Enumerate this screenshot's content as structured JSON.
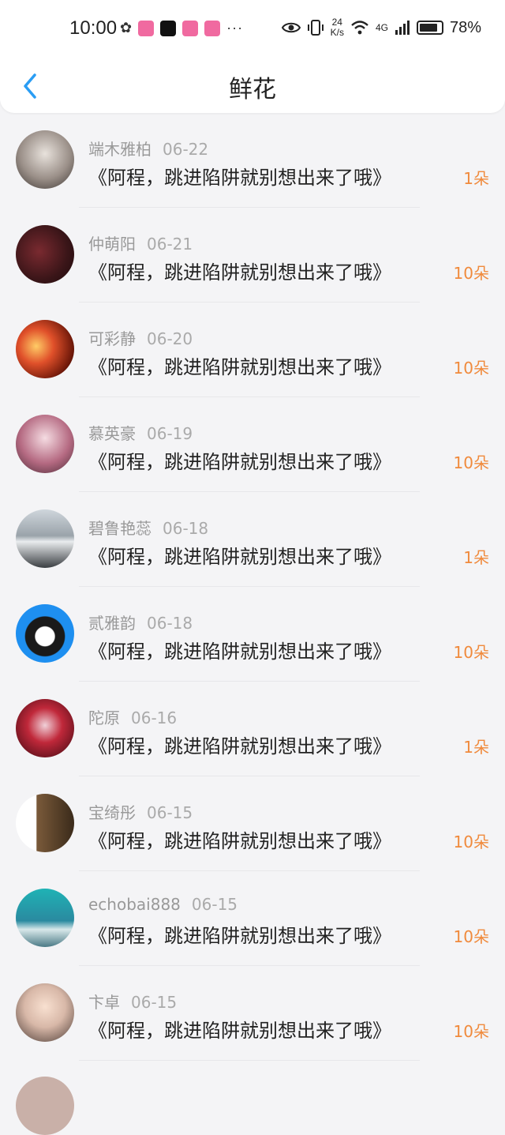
{
  "status_bar": {
    "time": "10:00",
    "speed_value": "24",
    "speed_unit": "K/s",
    "network": "4G",
    "battery": "78%"
  },
  "header": {
    "title": "鲜花"
  },
  "items": [
    {
      "name": "端木雅柏",
      "date": "06-22",
      "book": "《阿程，跳进陷阱就别想出来了哦》",
      "flowers": "1朵",
      "avatar": "anime-girl-avatar"
    },
    {
      "name": "仲萌阳",
      "date": "06-21",
      "book": "《阿程，跳进陷阱就别想出来了哦》",
      "flowers": "10朵",
      "avatar": "couple-photo-avatar"
    },
    {
      "name": "可彩静",
      "date": "06-20",
      "book": "《阿程，跳进陷阱就别想出来了哦》",
      "flowers": "10朵",
      "avatar": "candle-hearts-avatar"
    },
    {
      "name": "慕英豪",
      "date": "06-19",
      "book": "《阿程，跳进陷阱就别想出来了哦》",
      "flowers": "10朵",
      "avatar": "girl-photo-avatar"
    },
    {
      "name": "碧鲁艳蕊",
      "date": "06-18",
      "book": "《阿程，跳进陷阱就别想出来了哦》",
      "flowers": "1朵",
      "avatar": "car-avatar"
    },
    {
      "name": "贰雅韵",
      "date": "06-18",
      "book": "《阿程，跳进陷阱就别想出来了哦》",
      "flowers": "10朵",
      "avatar": "penguin-avatar"
    },
    {
      "name": "陀原",
      "date": "06-16",
      "book": "《阿程，跳进陷阱就别想出来了哦》",
      "flowers": "1朵",
      "avatar": "red-anime-avatar"
    },
    {
      "name": "宝绮彤",
      "date": "06-15",
      "book": "《阿程，跳进陷阱就别想出来了哦》",
      "flowers": "10朵",
      "avatar": "child-guitar-avatar"
    },
    {
      "name": "echobai888",
      "date": "06-15",
      "book": "《阿程，跳进陷阱就别想出来了哦》",
      "flowers": "10朵",
      "avatar": "sea-shoes-avatar"
    },
    {
      "name": "卞卓",
      "date": "06-15",
      "book": "《阿程，跳进陷阱就别想出来了哦》",
      "flowers": "10朵",
      "avatar": "little-girl-avatar"
    }
  ],
  "colors": {
    "accent": "#2a9df4",
    "flowers": "#f08a3c",
    "background": "#f4f4f6"
  }
}
